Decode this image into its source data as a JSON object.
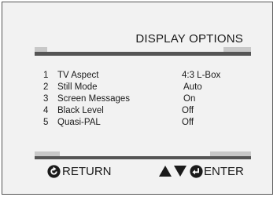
{
  "menu": {
    "title": "DISPLAY OPTIONS",
    "items": [
      {
        "num": "1",
        "label": "TV Aspect",
        "value": "4:3 L-Box"
      },
      {
        "num": "2",
        "label": "Still Mode",
        "value": "Auto"
      },
      {
        "num": "3",
        "label": "Screen Messages",
        "value": "On"
      },
      {
        "num": "4",
        "label": "Black Level",
        "value": "Off"
      },
      {
        "num": "5",
        "label": "Quasi-PAL",
        "value": "Off"
      }
    ]
  },
  "footer": {
    "return_label": "RETURN",
    "enter_label": "ENTER",
    "return_icon": "return-icon",
    "nav_icon": "up-down-arrows-icon",
    "enter_icon": "enter-icon"
  },
  "colors": {
    "background": "#f2f2f2",
    "bar_dark": "#555555",
    "bar_light": "#c8c8c8",
    "text": "#1a1a1a"
  }
}
